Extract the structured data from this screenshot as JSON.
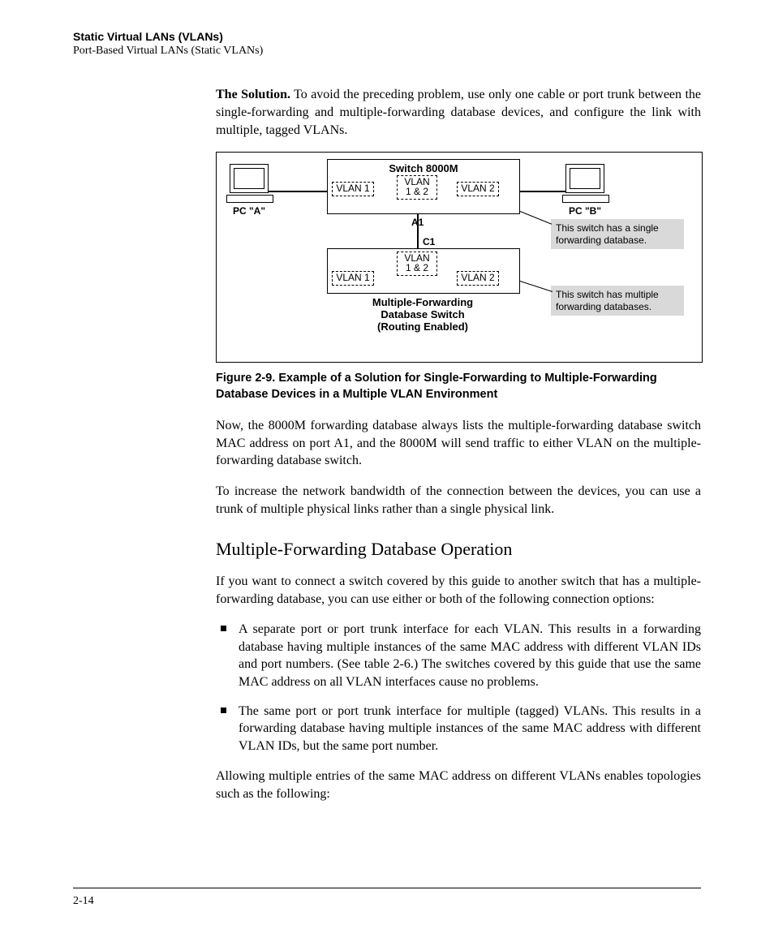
{
  "header": {
    "title": "Static Virtual LANs (VLANs)",
    "subtitle": "Port-Based Virtual LANs (Static VLANs)"
  },
  "solution": {
    "lead": "The Solution.",
    "body": "  To avoid the preceding problem, use only one cable or port trunk between the single-forwarding and multiple-forwarding database devices, and configure the link with multiple, tagged VLANs."
  },
  "diagram": {
    "pc_a": "PC \"A\"",
    "pc_b": "PC \"B\"",
    "switch_top": "Switch 8000M",
    "vlan1": "VLAN 1",
    "vlan12_a": "VLAN",
    "vlan12_b": "1 &  2",
    "vlan2": "VLAN 2",
    "port_a1": "A1",
    "port_c1": "C1",
    "bottom_vlan1": "VLAN 1",
    "bottom_vlan12_a": "VLAN",
    "bottom_vlan12_b": "1 & 2",
    "bottom_vlan2": "VLAN 2",
    "bottom_title_1": "Multiple-Forwarding",
    "bottom_title_2": "Database Switch",
    "bottom_title_3": "(Routing Enabled)",
    "callout_top": "This switch has a single forwarding database.",
    "callout_bottom": "This switch has multiple forwarding databases."
  },
  "fig_caption": "Figure 2-9.  Example of a Solution for Single-Forwarding to Multiple-Forwarding Database Devices in a Multiple VLAN Environment",
  "para_after_fig": "Now, the 8000M forwarding database always lists the multiple-forwarding database switch MAC address on port A1, and the 8000M will send traffic to either VLAN on the multiple-forwarding database switch.",
  "para_bandwidth": "To increase the network bandwidth of the connection between the devices, you can use a trunk of multiple physical links rather than a single physical link.",
  "h2": "Multiple-Forwarding Database Operation",
  "para_intro": "If you want to connect a switch covered by this guide to another switch that has a multiple-forwarding database, you can use either or both of the following connection options:",
  "bullets": [
    "A separate port or port trunk interface for each VLAN. This results in a forwarding database having multiple instances of the same MAC address with different VLAN IDs and port numbers. (See table 2-6.) The switches covered by this guide that use the same MAC address on all VLAN interfaces cause no problems.",
    "The same port or port trunk interface for multiple (tagged) VLANs. This results in a forwarding database having multiple instances of the same MAC address with different VLAN IDs, but the same port number."
  ],
  "para_closing": "Allowing multiple entries of the same MAC address on different VLANs enables topologies such as the following:",
  "page_number": "2-14"
}
